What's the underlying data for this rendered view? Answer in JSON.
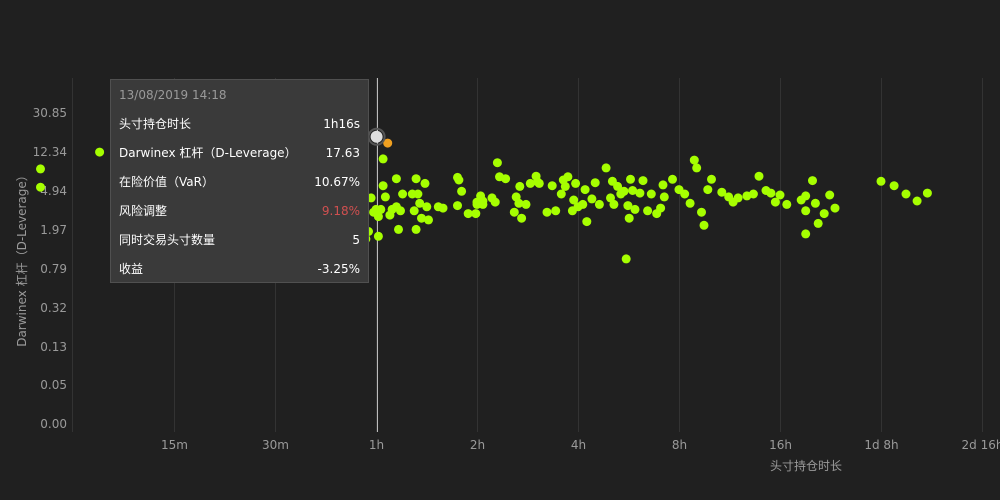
{
  "chart_data": {
    "type": "scatter",
    "xlabel": "头寸持仓时长",
    "ylabel": "Darwinex 杠杆（D-Leverage）",
    "x_scale": "log",
    "x_ticks": [
      "15m",
      "30m",
      "1h",
      "2h",
      "4h",
      "8h",
      "16h",
      "1d 8h",
      "2d 16h"
    ],
    "y_ticks": [
      "0.00",
      "0.05",
      "0.13",
      "0.32",
      "0.79",
      "1.97",
      "4.94",
      "12.34",
      "30.85"
    ],
    "grid": true,
    "colors": {
      "point": "#a6ff00",
      "highlight": "#f0a020",
      "hovered": "#dddddd"
    },
    "hovered_point": {
      "x": "1h16s",
      "y": 17.63
    },
    "highlighted_point": {
      "x": "1h5m",
      "y": 15.2
    },
    "points": [
      [
        "6m",
        8.3
      ],
      [
        "6m",
        5.4
      ],
      [
        "9m",
        12.3
      ],
      [
        "52m",
        5.0
      ],
      [
        "54m",
        3.1
      ],
      [
        "55m",
        2.7
      ],
      [
        "56m",
        1.6
      ],
      [
        "57m",
        1.9
      ],
      [
        "58m",
        4.2
      ],
      [
        "59m",
        3.0
      ],
      [
        "1h",
        3.2
      ],
      [
        "1h1m",
        1.7
      ],
      [
        "1h1m",
        2.7
      ],
      [
        "1h2m",
        3.2
      ],
      [
        "1h3m",
        10.5
      ],
      [
        "1h3m",
        5.6
      ],
      [
        "1h4m",
        4.3
      ],
      [
        "1h6m",
        2.8
      ],
      [
        "1h7m",
        3.2
      ],
      [
        "1h9m",
        6.6
      ],
      [
        "1h9m",
        3.4
      ],
      [
        "1h10m",
        2.0
      ],
      [
        "1h11m",
        3.1
      ],
      [
        "1h12m",
        4.6
      ],
      [
        "1h17m",
        4.6
      ],
      [
        "1h18m",
        3.1
      ],
      [
        "1h19m",
        2.0
      ],
      [
        "1h19m",
        6.6
      ],
      [
        "1h20m",
        4.6
      ],
      [
        "1h21m",
        3.7
      ],
      [
        "1h22m",
        2.6
      ],
      [
        "1h24m",
        5.9
      ],
      [
        "1h25m",
        3.4
      ],
      [
        "1h26m",
        2.5
      ],
      [
        "1h32m",
        3.4
      ],
      [
        "1h35m",
        3.3
      ],
      [
        "1h45m",
        3.5
      ],
      [
        "1h45m",
        6.8
      ],
      [
        "1h46m",
        6.4
      ],
      [
        "1h48m",
        4.9
      ],
      [
        "1h53m",
        2.9
      ],
      [
        "1h59m",
        2.9
      ],
      [
        "2h",
        3.8
      ],
      [
        "2h",
        3.6
      ],
      [
        "2h3m",
        4.4
      ],
      [
        "2h5m",
        3.9
      ],
      [
        "2h5m",
        3.6
      ],
      [
        "2h13m",
        4.2
      ],
      [
        "2h16m",
        3.8
      ],
      [
        "2h18m",
        9.6
      ],
      [
        "2h20m",
        6.9
      ],
      [
        "2h26m",
        6.6
      ],
      [
        "2h35m",
        3.0
      ],
      [
        "2h37m",
        4.3
      ],
      [
        "2h40m",
        3.7
      ],
      [
        "2h41m",
        5.5
      ],
      [
        "2h43m",
        2.6
      ],
      [
        "2h48m",
        3.6
      ],
      [
        "2h53m",
        5.9
      ],
      [
        "3h",
        7.0
      ],
      [
        "3h2m",
        6.1
      ],
      [
        "3h4m",
        5.9
      ],
      [
        "3h14m",
        3.0
      ],
      [
        "3h21m",
        5.6
      ],
      [
        "3h26m",
        3.1
      ],
      [
        "3h34m",
        4.6
      ],
      [
        "3h37m",
        6.4
      ],
      [
        "3h40m",
        5.5
      ],
      [
        "3h44m",
        6.9
      ],
      [
        "3h51m",
        3.1
      ],
      [
        "3h53m",
        4.0
      ],
      [
        "3h56m",
        5.9
      ],
      [
        "4h",
        3.4
      ],
      [
        "4h8m",
        3.6
      ],
      [
        "4h12m",
        5.1
      ],
      [
        "4h15m",
        2.4
      ],
      [
        "4h24m",
        4.1
      ],
      [
        "4h30m",
        6.0
      ],
      [
        "4h38m",
        3.6
      ],
      [
        "4h51m",
        8.5
      ],
      [
        "5h",
        4.2
      ],
      [
        "5h4m",
        6.2
      ],
      [
        "5h7m",
        3.6
      ],
      [
        "5h15m",
        5.5
      ],
      [
        "5h22m",
        4.6
      ],
      [
        "5h29m",
        4.9
      ],
      [
        "5h34m",
        1.0
      ],
      [
        "5h38m",
        3.5
      ],
      [
        "5h41m",
        2.6
      ],
      [
        "5h44m",
        6.5
      ],
      [
        "5h49m",
        5.0
      ],
      [
        "5h55m",
        3.2
      ],
      [
        "6h7m",
        4.7
      ],
      [
        "6h15m",
        6.3
      ],
      [
        "6h27m",
        3.1
      ],
      [
        "6h37m",
        4.6
      ],
      [
        "6h52m",
        2.9
      ],
      [
        "7h3m",
        3.3
      ],
      [
        "7h10m",
        5.7
      ],
      [
        "7h14m",
        4.3
      ],
      [
        "7h39m",
        6.5
      ],
      [
        "8h",
        5.1
      ],
      [
        "8h19m",
        4.6
      ],
      [
        "8h38m",
        3.7
      ],
      [
        "8h53m",
        10.2
      ],
      [
        "9h2m",
        8.5
      ],
      [
        "9h20m",
        3.0
      ],
      [
        "9h30m",
        2.2
      ],
      [
        "9h45m",
        5.1
      ],
      [
        "10h",
        6.5
      ],
      [
        "10h44m",
        4.8
      ],
      [
        "11h15m",
        4.3
      ],
      [
        "11h36m",
        3.8
      ],
      [
        "12h",
        4.2
      ],
      [
        "12h45m",
        4.4
      ],
      [
        "13h20m",
        4.6
      ],
      [
        "13h51m",
        7.0
      ],
      [
        "14h32m",
        5.0
      ],
      [
        "15h2m",
        4.7
      ],
      [
        "15h30m",
        3.8
      ],
      [
        "16h",
        4.5
      ],
      [
        "16h46m",
        3.6
      ],
      [
        "18h30m",
        4.0
      ],
      [
        "19h5m",
        4.4
      ],
      [
        "19h5m",
        3.1
      ],
      [
        "19h5m",
        1.8
      ],
      [
        "20h",
        6.3
      ],
      [
        "20h24m",
        3.7
      ],
      [
        "20h48m",
        2.3
      ],
      [
        "21h40m",
        2.9
      ],
      [
        "22h30m",
        4.5
      ],
      [
        "23h20m",
        3.3
      ],
      [
        "1d 8h",
        6.2
      ],
      [
        "1d 11h",
        5.6
      ],
      [
        "1d 14h",
        4.6
      ],
      [
        "1d 17h",
        3.9
      ],
      [
        "1d 20h",
        4.7
      ]
    ]
  },
  "tooltip": {
    "date": "13/08/2019 14:18",
    "rows": [
      {
        "label": "头寸持仓时长",
        "value": "1h16s",
        "color": "#ffffff"
      },
      {
        "label": "Darwinex 杠杆（D-Leverage）",
        "value": "17.63",
        "color": "#ffffff"
      },
      {
        "label": "在险价值（VaR）",
        "value": "10.67%",
        "color": "#ffffff"
      },
      {
        "label": "风险调整",
        "value": "9.18%",
        "color": "#d05050"
      },
      {
        "label": "同时交易头寸数量",
        "value": "5",
        "color": "#ffffff"
      },
      {
        "label": "收益",
        "value": "-3.25%",
        "color": "#ffffff"
      }
    ]
  }
}
